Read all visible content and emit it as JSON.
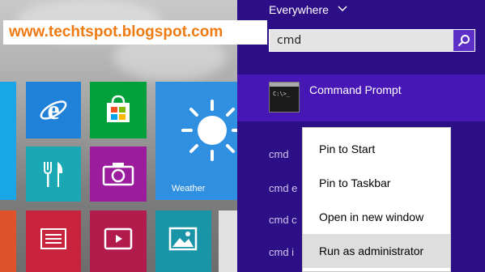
{
  "watermark": {
    "text": "www.techtspot.blogspot.com"
  },
  "start_screen": {
    "tiles": [
      {
        "name": "ie",
        "icon": "internet-explorer-icon",
        "color": "#1f81d8"
      },
      {
        "name": "store",
        "icon": "store-bag-icon",
        "color": "#00a13a"
      },
      {
        "name": "weather",
        "icon": "sun-icon",
        "color": "#2f8fe0",
        "label": "Weather"
      },
      {
        "name": "food",
        "icon": "fork-knife-icon",
        "color": "#1aa8b5"
      },
      {
        "name": "camera",
        "icon": "camera-icon",
        "color": "#9b1c9c"
      },
      {
        "name": "news",
        "icon": "news-icon",
        "color": "#c8233d"
      },
      {
        "name": "video",
        "icon": "video-icon",
        "color": "#b21b4b"
      },
      {
        "name": "photos",
        "icon": "photos-icon",
        "color": "#1a95a8"
      }
    ]
  },
  "search": {
    "scope": "Everywhere",
    "query": "cmd",
    "top_result": "Command Prompt",
    "suggestions": [
      "cmd",
      "cmd e",
      "cmd c",
      "cmd i"
    ]
  },
  "context_menu": {
    "items": [
      "Pin to Start",
      "Pin to Taskbar",
      "Open in new window",
      "Run as administrator"
    ],
    "highlighted_index": 3
  },
  "colors": {
    "search_pane_bg": "#2c0f86",
    "selected_result_bg": "#4617b4",
    "search_button_bg": "#5c2fc7",
    "watermark_text": "#f07a12"
  }
}
